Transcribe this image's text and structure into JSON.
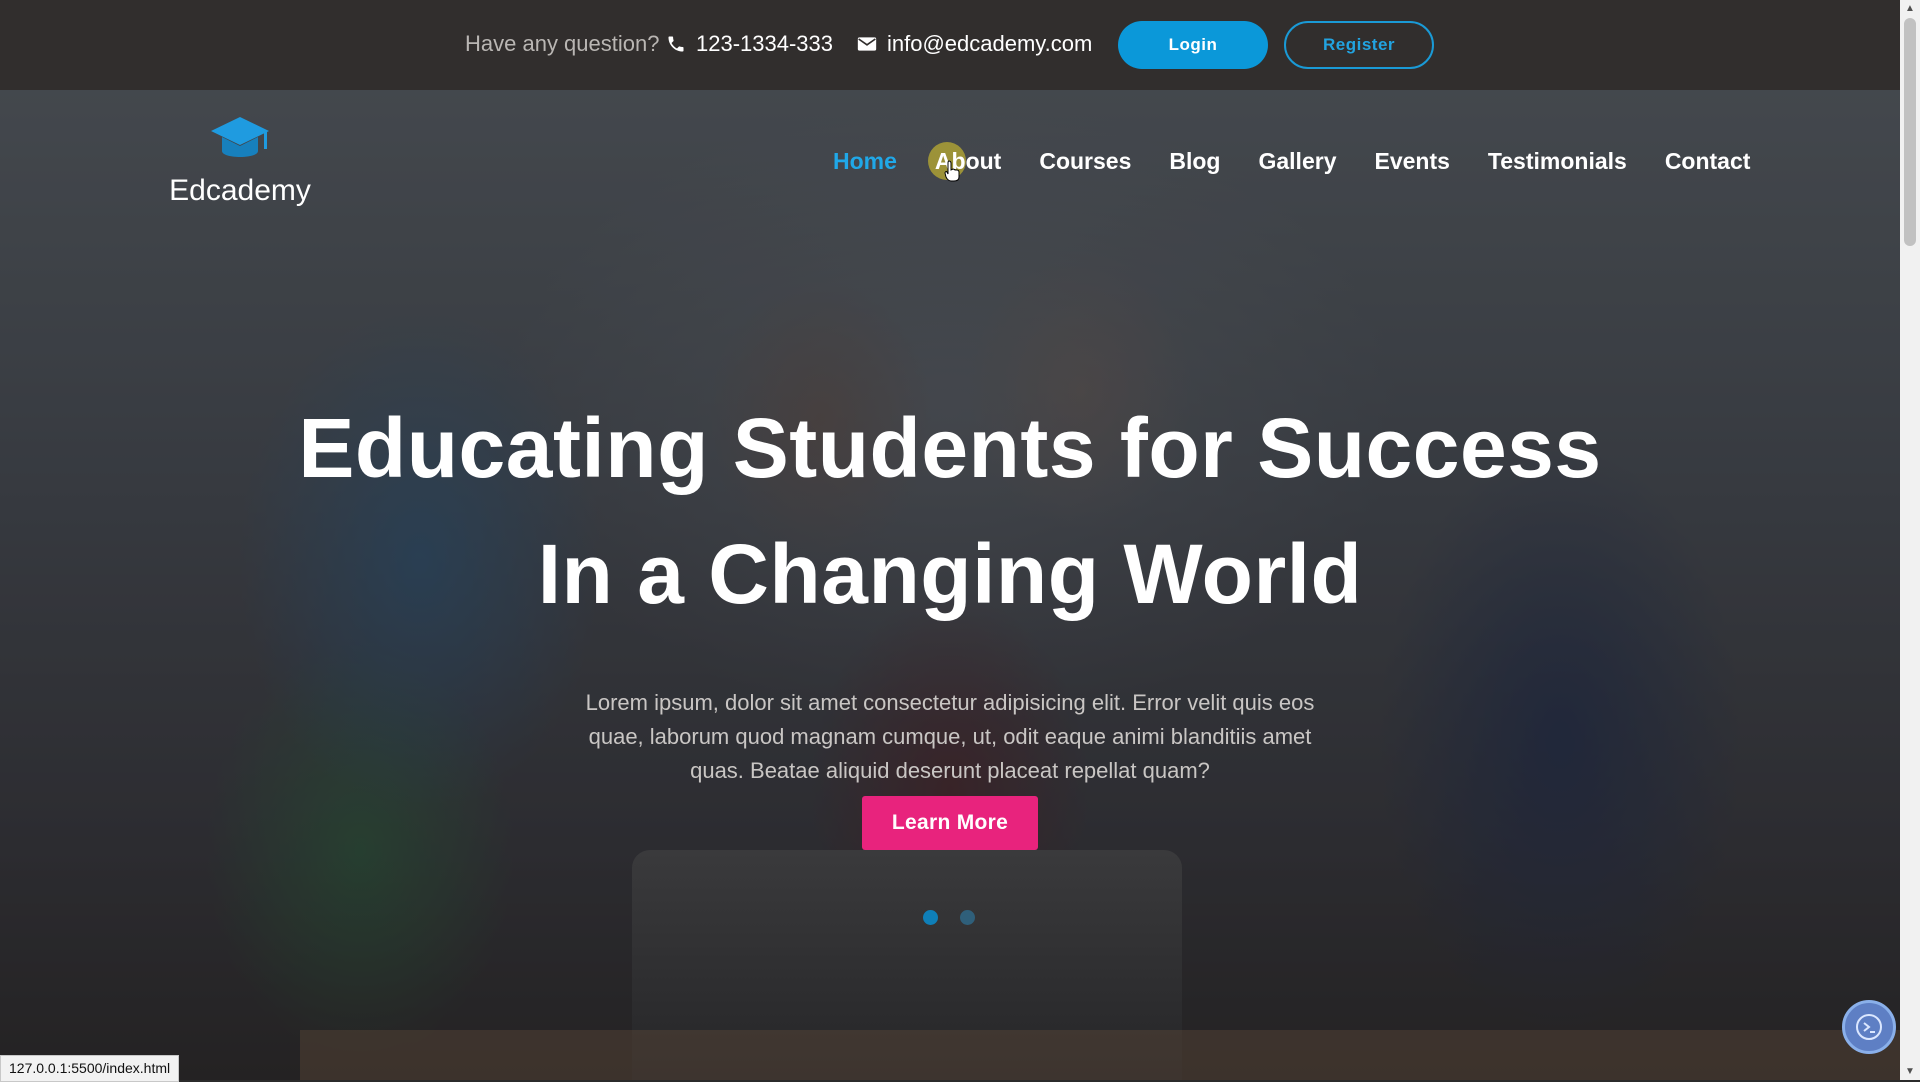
{
  "topbar": {
    "question": "Have any question?",
    "phone": "123-1334-333",
    "email": "info@edcademy.com",
    "login_label": "Login",
    "register_label": "Register"
  },
  "brand": {
    "name": "Edcademy",
    "accent_color": "#0b98d9",
    "cta_color": "#e8237d"
  },
  "nav": {
    "items": [
      {
        "label": "Home",
        "active": true
      },
      {
        "label": "About",
        "active": false
      },
      {
        "label": "Courses",
        "active": false
      },
      {
        "label": "Blog",
        "active": false
      },
      {
        "label": "Gallery",
        "active": false
      },
      {
        "label": "Events",
        "active": false
      },
      {
        "label": "Testimonials",
        "active": false
      },
      {
        "label": "Contact",
        "active": false
      }
    ]
  },
  "hero": {
    "headline_line1": "Educating Students for Success",
    "headline_line2": "In a Changing World",
    "lead": "Lorem ipsum, dolor sit amet consectetur adipisicing elit. Error velit quis eos quae, laborum quod magnam cumque, ut, odit eaque animi blanditiis amet quas. Beatae aliquid deserunt placeat repellat quam?",
    "cta_label": "Learn More",
    "slides_total": 2,
    "active_slide": 1
  },
  "statusbar": {
    "url": "127.0.0.1:5500/index.html"
  },
  "icons": {
    "phone": "phone-icon",
    "mail": "envelope-icon",
    "logo": "graduation-cap-icon",
    "chat": "chat-widget-icon"
  }
}
